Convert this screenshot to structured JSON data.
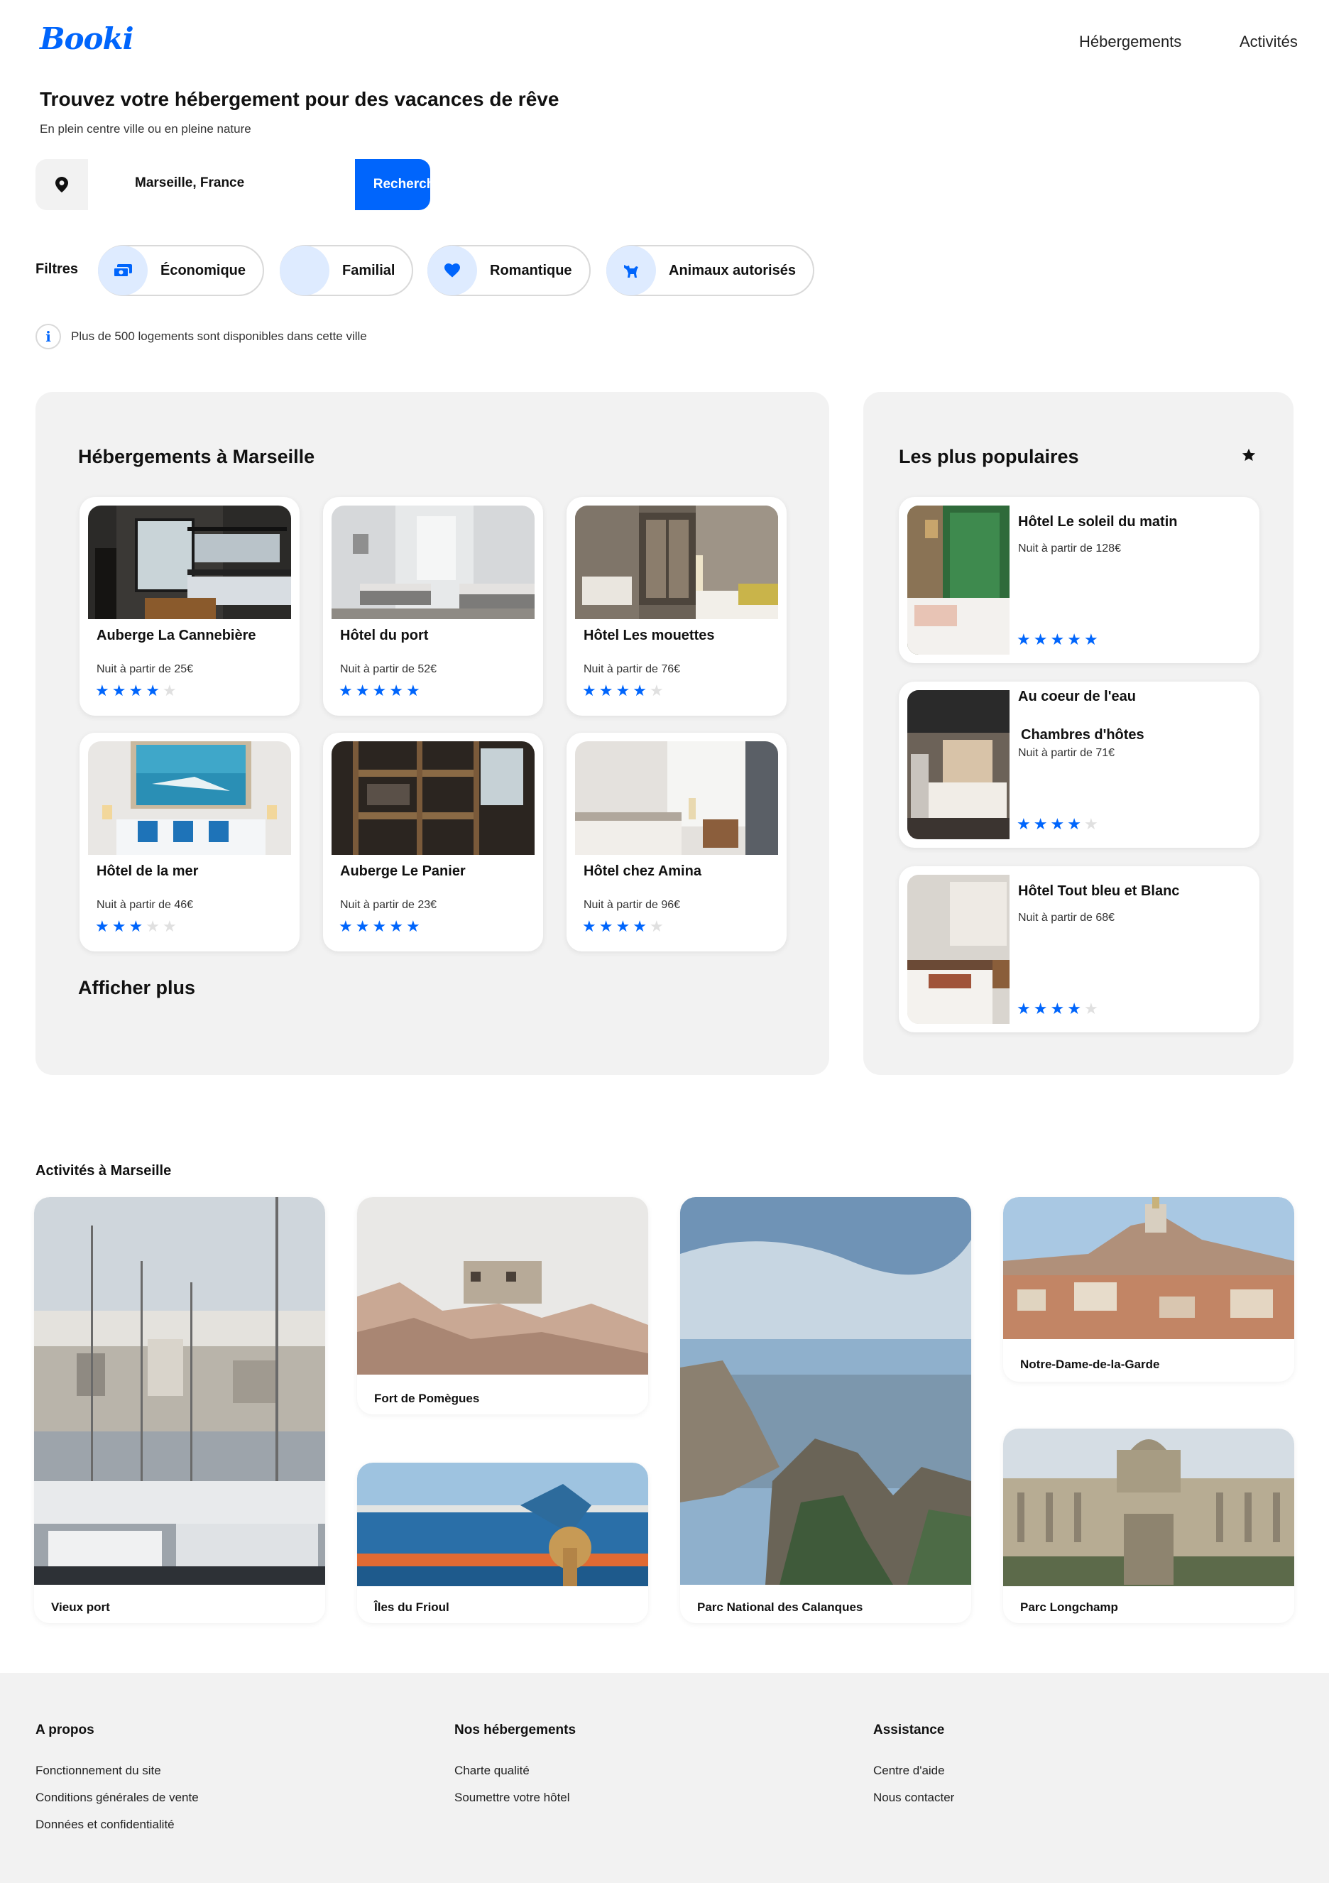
{
  "header": {
    "logo": "Booki",
    "nav": [
      "Hébergements",
      "Activités"
    ]
  },
  "hero": {
    "title": "Trouvez votre hébergement pour des vacances de rêve",
    "subtitle": "En plein centre ville ou en pleine nature"
  },
  "search": {
    "value": "Marseille, France",
    "button": "Rechercher",
    "icon": "location-pin-icon"
  },
  "filters": {
    "label": "Filtres",
    "items": [
      {
        "label": "Économique",
        "icon": "money-icon"
      },
      {
        "label": "Familial",
        "icon": "family-icon"
      },
      {
        "label": "Romantique",
        "icon": "heart-icon"
      },
      {
        "label": "Animaux autorisés",
        "icon": "dog-icon"
      }
    ]
  },
  "info": {
    "icon": "info-icon",
    "text": "Plus de 500 logements sont disponibles dans cette ville"
  },
  "colors": {
    "accent": "#0065FC",
    "accent_light": "#DEEBFF",
    "panel_bg": "#F2F2F2",
    "star_off": "#E0E0E0"
  },
  "lodgings": {
    "title": "Hébergements à Marseille",
    "more": "Afficher plus",
    "items": [
      {
        "name": "Auberge La Cannebière",
        "price": "Nuit à partir de 25€",
        "rating": 4
      },
      {
        "name": "Hôtel du port",
        "price": "Nuit à partir de 52€",
        "rating": 5
      },
      {
        "name": "Hôtel Les mouettes",
        "price": "Nuit à partir de 76€",
        "rating": 4
      },
      {
        "name": "Hôtel de la mer",
        "price": "Nuit à partir de 46€",
        "rating": 3
      },
      {
        "name": "Auberge Le Panier",
        "price": "Nuit à partir de 23€",
        "rating": 5
      },
      {
        "name": "Hôtel chez Amina",
        "price": "Nuit à partir de 96€",
        "rating": 4
      }
    ]
  },
  "popular": {
    "title": "Les plus populaires",
    "icon": "star-icon",
    "items": [
      {
        "name": "Hôtel Le soleil du matin",
        "name2": "",
        "price": "Nuit à partir de 128€",
        "rating": 5
      },
      {
        "name": "Au coeur de l'eau",
        "name2": "Chambres d'hôtes",
        "price": "Nuit à partir de 71€",
        "rating": 4
      },
      {
        "name": "Hôtel Tout bleu et Blanc",
        "name2": "",
        "price": "Nuit à partir de 68€",
        "rating": 4
      }
    ]
  },
  "activities": {
    "title": "Activités à Marseille",
    "items": [
      {
        "name": "Vieux port"
      },
      {
        "name": "Fort de Pomègues"
      },
      {
        "name": "Îles du Frioul"
      },
      {
        "name": "Parc National des Calanques"
      },
      {
        "name": "Notre-Dame-de-la-Garde"
      },
      {
        "name": "Parc Longchamp"
      }
    ]
  },
  "footer": {
    "columns": [
      {
        "title": "A propos",
        "links": [
          "Fonctionnement du site",
          "Conditions générales de vente",
          "Données et confidentialité"
        ]
      },
      {
        "title": "Nos hébergements",
        "links": [
          "Charte qualité",
          "Soumettre votre hôtel"
        ]
      },
      {
        "title": "Assistance",
        "links": [
          "Centre d'aide",
          "Nous contacter"
        ]
      }
    ]
  }
}
